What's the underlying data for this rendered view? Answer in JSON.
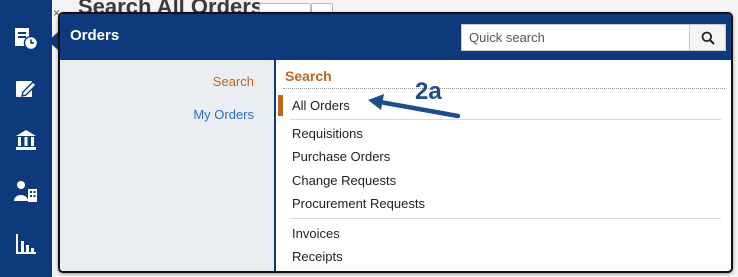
{
  "background": {
    "page_title": "Search All Orders",
    "close_glyph": "×"
  },
  "rail": [
    {
      "icon": "orders-icon",
      "active": true
    },
    {
      "icon": "edit-icon"
    },
    {
      "icon": "bank-icon"
    },
    {
      "icon": "person-building-icon"
    },
    {
      "icon": "bar-chart-icon"
    }
  ],
  "popup": {
    "title": "Orders",
    "search": {
      "placeholder": "Quick search",
      "button_icon": "search-icon"
    },
    "left_nav": {
      "search": "Search",
      "my_orders": "My Orders"
    },
    "section_title": "Search",
    "items": {
      "all_orders": "All Orders",
      "requisitions": "Requisitions",
      "purchase_orders": "Purchase Orders",
      "change_requests": "Change Requests",
      "procurement_requests": "Procurement Requests",
      "invoices": "Invoices",
      "receipts": "Receipts"
    }
  },
  "annotation": {
    "label": "2a"
  },
  "colors": {
    "navy": "#0d3a7c",
    "accent_orange": "#c0661c",
    "link_blue": "#2a6ebb",
    "annotation_blue": "#1d4e8f"
  }
}
